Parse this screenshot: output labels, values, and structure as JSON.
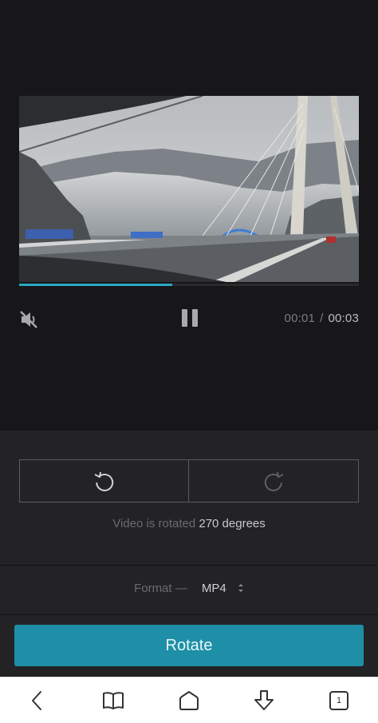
{
  "player": {
    "current_time": "00:01",
    "separator": "/",
    "total_time": "00:03",
    "progress_fraction": 0.45,
    "muted": true,
    "state": "playing",
    "accent_color": "#29a9c4"
  },
  "rotation": {
    "info_prefix": "Video is rotated",
    "degrees_text": "270 degrees",
    "rotate_left_icon": "rotate-ccw-icon",
    "rotate_right_icon": "rotate-cw-icon"
  },
  "format": {
    "label": "Format —",
    "value": "MP4",
    "icon": "sort-arrows-icon"
  },
  "action": {
    "rotate_label": "Rotate",
    "color": "#1e8fa6"
  },
  "browser_nav": {
    "icons": [
      "back-icon",
      "bookmarks-icon",
      "home-icon",
      "download-icon",
      "tabs-icon"
    ],
    "tab_count": "1"
  }
}
